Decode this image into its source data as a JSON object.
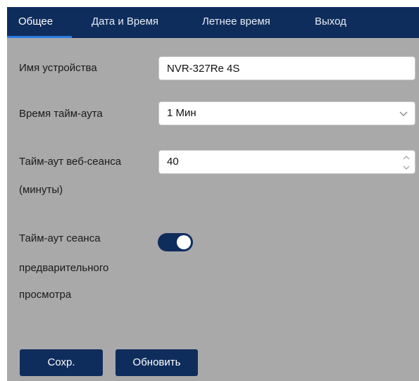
{
  "tabs": [
    {
      "label": "Общее",
      "active": true
    },
    {
      "label": "Дата и Время",
      "active": false
    },
    {
      "label": "Летнее время",
      "active": false
    },
    {
      "label": "Выход",
      "active": false
    }
  ],
  "form": {
    "device_name": {
      "label": "Имя устройства",
      "value": "NVR-327Re 4S"
    },
    "timeout": {
      "label": "Время тайм-аута",
      "value": "1  Мин"
    },
    "web_session": {
      "label_line1": "Тайм-аут веб-сеанса",
      "label_line2": "(минуты)",
      "value": "40"
    },
    "preview_session": {
      "label_line1": "Тайм-аут сеанса",
      "label_line2": "предварительного",
      "label_line3": "просмотра",
      "enabled": true
    }
  },
  "buttons": {
    "save_label": "Сохр.",
    "refresh_label": "Обновить"
  },
  "icons": {
    "select": "chevron-down-icon",
    "spinner": "spinner-arrows-icon"
  },
  "colors": {
    "primary": "#0f2d5c",
    "active_underline": "#2b7de0",
    "panel": "#a9a9a9"
  }
}
